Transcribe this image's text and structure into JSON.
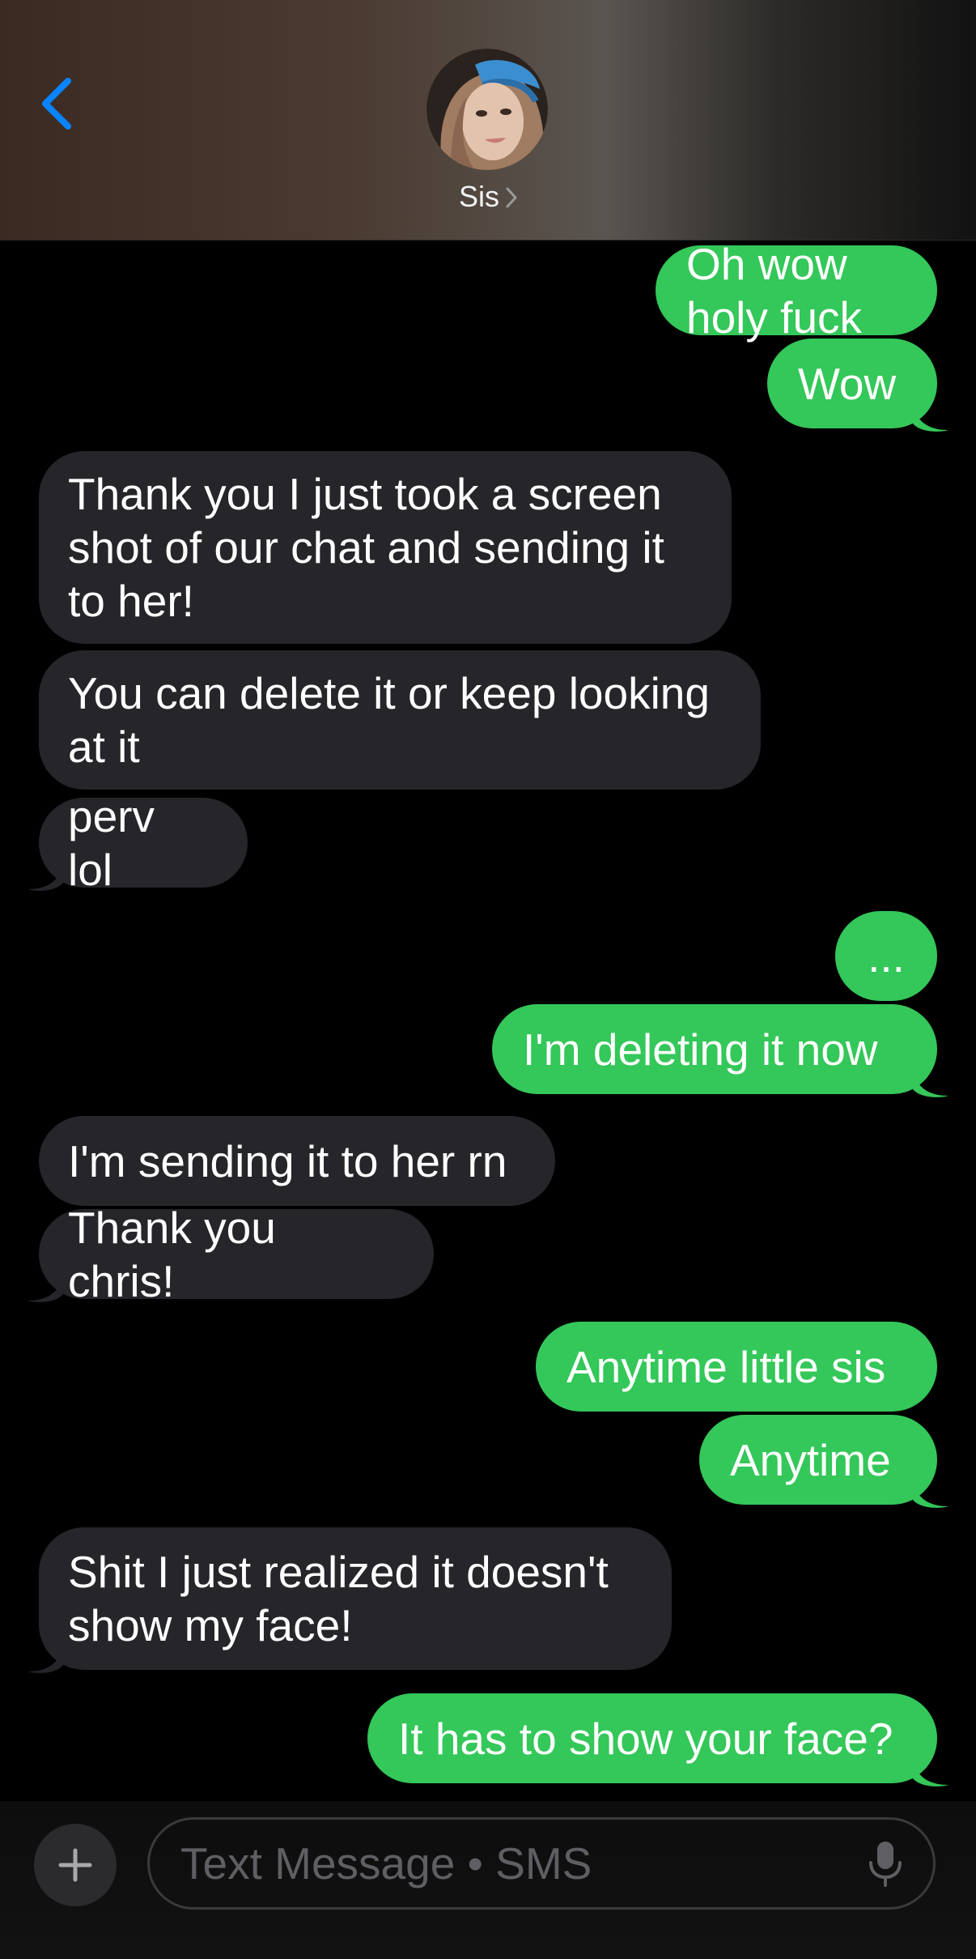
{
  "header": {
    "contact_name": "Sis",
    "back_icon": "chevron-left-icon",
    "accent_color": "#0a84ff"
  },
  "messages": [
    {
      "side": "out",
      "text": "Oh wow holy fuck"
    },
    {
      "side": "out",
      "text": "Wow"
    },
    {
      "side": "in",
      "text": "Thank you I just took a screen shot of our chat and sending it to her!"
    },
    {
      "side": "in",
      "text": "You can delete it or keep looking at it"
    },
    {
      "side": "in",
      "text": "perv lol"
    },
    {
      "side": "out",
      "text": "..."
    },
    {
      "side": "out",
      "text": "I'm deleting it now"
    },
    {
      "side": "in",
      "text": "I'm sending it to her rn"
    },
    {
      "side": "in",
      "text": "Thank you chris!"
    },
    {
      "side": "out",
      "text": "Anytime little sis"
    },
    {
      "side": "out",
      "text": "Anytime"
    },
    {
      "side": "in",
      "text": "Shit I just realized it doesn't show my face!"
    },
    {
      "side": "out",
      "text": "It has to show your face?"
    }
  ],
  "composer": {
    "placeholder": "Text Message • SMS",
    "plus_icon": "plus-icon",
    "mic_icon": "microphone-icon"
  },
  "colors": {
    "outgoing_bubble": "#34c759",
    "incoming_bubble": "#26252a",
    "background": "#000000"
  }
}
